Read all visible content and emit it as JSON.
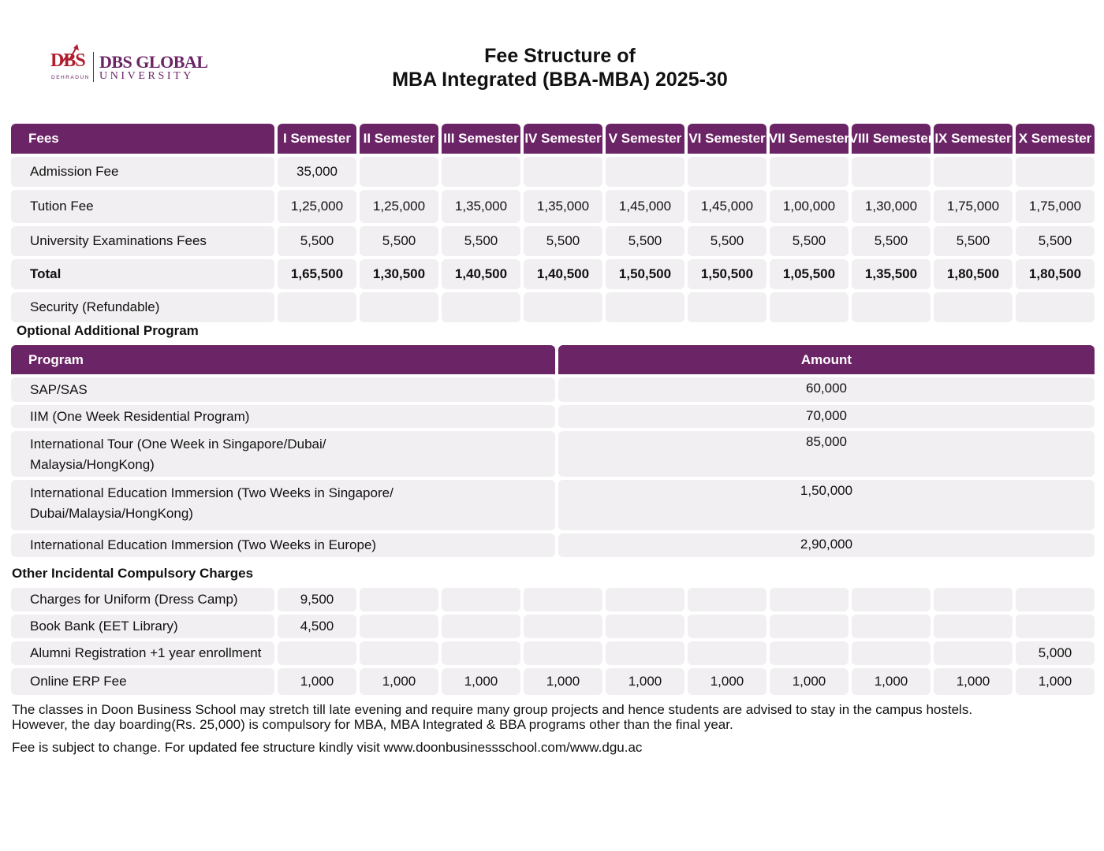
{
  "logo": {
    "mark": "DBS",
    "city": "DEHRADUN",
    "name": "DBS GLOBAL",
    "subname": "UNIVERSITY"
  },
  "title": {
    "line1": "Fee Structure of",
    "line2": "MBA Integrated (BBA-MBA) 2025-30"
  },
  "fees_table": {
    "header_label": "Fees",
    "semesters": [
      "I Semester",
      "II Semester",
      "III Semester",
      "IV Semester",
      "V Semester",
      "VI Semester",
      "VII Semester",
      "VIII Semester",
      "IX Semester",
      "X Semester"
    ],
    "rows": [
      {
        "label": "Admission Fee",
        "values": [
          "35,000",
          "",
          "",
          "",
          "",
          "",
          "",
          "",
          "",
          ""
        ]
      },
      {
        "label": "Tution Fee",
        "values": [
          "1,25,000",
          "1,25,000",
          "1,35,000",
          "1,35,000",
          "1,45,000",
          "1,45,000",
          "1,00,000",
          "1,30,000",
          "1,75,000",
          "1,75,000"
        ]
      },
      {
        "label": "University Examinations Fees",
        "values": [
          "5,500",
          "5,500",
          "5,500",
          "5,500",
          "5,500",
          "5,500",
          "5,500",
          "5,500",
          "5,500",
          "5,500"
        ]
      },
      {
        "label": "Total",
        "bold": true,
        "values": [
          "1,65,500",
          "1,30,500",
          "1,40,500",
          "1,40,500",
          "1,50,500",
          "1,50,500",
          "1,05,500",
          "1,35,500",
          "1,80,500",
          "1,80,500"
        ]
      },
      {
        "label": "Security (Refundable)",
        "values": [
          "",
          "",
          "",
          "",
          "",
          "",
          "",
          "",
          "",
          ""
        ]
      }
    ]
  },
  "optional_section": {
    "heading": "Optional Additional Program",
    "col_program": "Program",
    "col_amount": "Amount",
    "rows": [
      {
        "program": "SAP/SAS",
        "amount": "60,000"
      },
      {
        "program": "IIM (One Week Residential Program)",
        "amount": "70,000"
      },
      {
        "program_lines": [
          "International Tour (One Week in Singapore/Dubai/",
          "Malaysia/HongKong)"
        ],
        "amount": "85,000"
      },
      {
        "program_lines": [
          "International Education Immersion (Two Weeks in Singapore/",
          "Dubai/Malaysia/HongKong)"
        ],
        "amount": "1,50,000"
      },
      {
        "program": "International Education Immersion (Two Weeks in Europe)",
        "amount": "2,90,000"
      }
    ]
  },
  "charges_section": {
    "heading": "Other Incidental Compulsory Charges",
    "rows": [
      {
        "label": "Charges for Uniform (Dress Camp)",
        "values": [
          "9,500",
          "",
          "",
          "",
          "",
          "",
          "",
          "",
          "",
          ""
        ]
      },
      {
        "label": "Book Bank (EET Library)",
        "values": [
          "4,500",
          "",
          "",
          "",
          "",
          "",
          "",
          "",
          "",
          ""
        ]
      },
      {
        "label": "Alumni Registration +1 year enrollment",
        "values": [
          "",
          "",
          "",
          "",
          "",
          "",
          "",
          "",
          "",
          "5,000"
        ]
      },
      {
        "label": "Online ERP Fee",
        "values": [
          "1,000",
          "1,000",
          "1,000",
          "1,000",
          "1,000",
          "1,000",
          "1,000",
          "1,000",
          "1,000",
          "1,000"
        ]
      }
    ]
  },
  "notes": {
    "line1": "The classes in Doon Business School may stretch till late evening and require many group projects and hence students are advised to stay in the campus hostels.",
    "line2": "However, the day boarding(Rs. 25,000) is compulsory for MBA, MBA Integrated & BBA programs other than the final year.",
    "line3": "Fee is subject to change. For updated fee structure kindly visit www.doonbusinessschool.com/www.dgu.ac"
  },
  "colors": {
    "header_bg": "#6b2466",
    "cell_bg": "#f1eff1",
    "logo_red": "#b01e2e"
  }
}
